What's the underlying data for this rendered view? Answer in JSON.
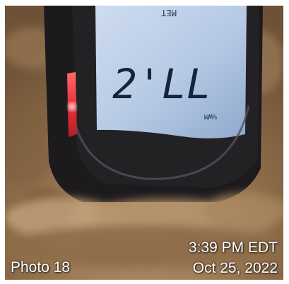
{
  "photo": {
    "label": "Photo 18",
    "timestamp_time": "3:39 PM EDT",
    "timestamp_date": "Oct 25, 2022"
  },
  "device_display": {
    "reading": "2'LL",
    "top_text": "MET",
    "unit_text": "%WM"
  },
  "colors": {
    "carpet": "#8a6a48",
    "device_body": "#1c1a1d",
    "lcd_screen": "#b8cde6",
    "indicator_red": "#e8323a",
    "caption_text": "#ffffff"
  }
}
